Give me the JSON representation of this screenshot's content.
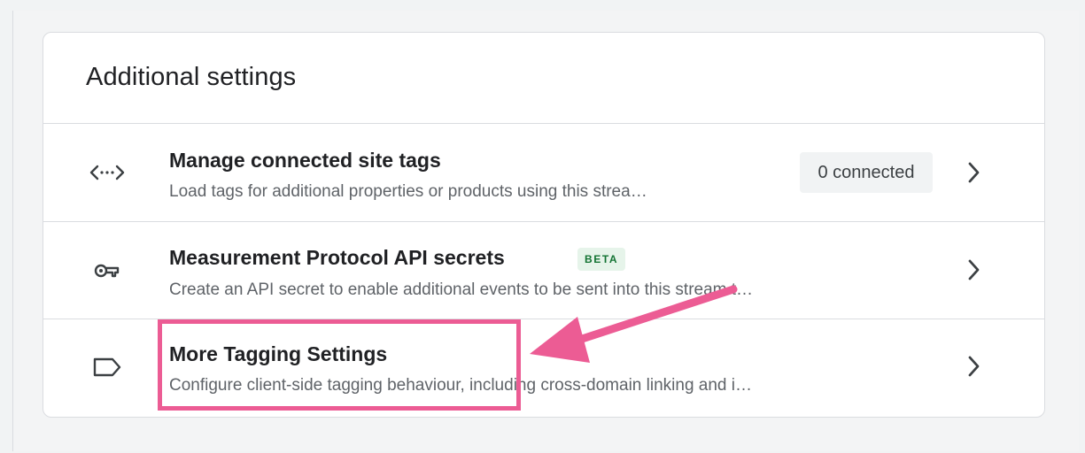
{
  "card": {
    "title": "Additional settings"
  },
  "rows": [
    {
      "title": "Manage connected site tags",
      "description": "Load tags for additional properties or products using this strea…",
      "chip": "0 connected",
      "icon": "code-icon"
    },
    {
      "title": "Measurement Protocol API secrets",
      "badge": "BETA",
      "description": "Create an API secret to enable additional events to be sent into this stream t…",
      "icon": "key-icon"
    },
    {
      "title": "More Tagging Settings",
      "description": "Configure client-side tagging behaviour, including cross-domain linking and i…",
      "icon": "label-icon"
    }
  ],
  "annotation": {
    "color": "#ec5c94"
  },
  "colors": {
    "beta_bg": "#e6f4ea",
    "beta_text": "#137333",
    "divider": "#dadce0"
  }
}
